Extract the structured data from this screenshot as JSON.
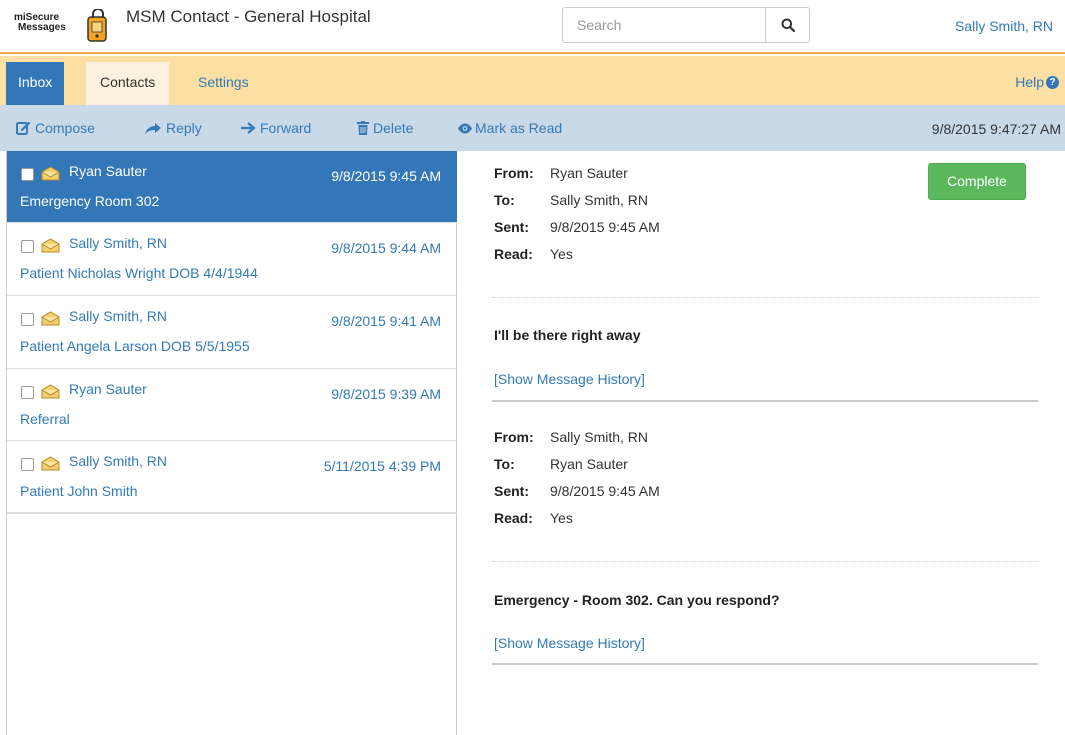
{
  "app": {
    "logo_line1": "miSecure",
    "logo_line2": "Messages",
    "title": "MSM Contact - General Hospital",
    "search_placeholder": "Search",
    "user_name": "Sally Smith, RN"
  },
  "nav": {
    "tabs": [
      {
        "label": "Inbox",
        "active": true
      },
      {
        "label": "Contacts",
        "active": false
      },
      {
        "label": "Settings",
        "active": false
      }
    ],
    "help_label": "Help",
    "help_icon": "question-circle-icon"
  },
  "toolbar": {
    "compose": "Compose",
    "reply": "Reply",
    "forward": "Forward",
    "delete": "Delete",
    "mark_read": "Mark as Read",
    "timestamp": "9/8/2015 9:47:27 AM"
  },
  "messages": [
    {
      "sender": "Ryan Sauter",
      "date": "9/8/2015 9:45 AM",
      "subject": "Emergency Room 302"
    },
    {
      "sender": "Sally Smith, RN",
      "date": "9/8/2015 9:44 AM",
      "subject": "Patient Nicholas Wright DOB 4/4/1944"
    },
    {
      "sender": "Sally Smith, RN",
      "date": "9/8/2015 9:41 AM",
      "subject": "Patient Angela Larson DOB 5/5/1955"
    },
    {
      "sender": "Ryan Sauter",
      "date": "9/8/2015 9:39 AM",
      "subject": "Referral"
    },
    {
      "sender": "Sally Smith, RN",
      "date": "5/11/2015 4:39 PM",
      "subject": "Patient John Smith"
    }
  ],
  "detail": {
    "labels": {
      "from": "From:",
      "to": "To:",
      "sent": "Sent:",
      "read": "Read:"
    },
    "complete_label": "Complete",
    "thread": [
      {
        "from": "Ryan Sauter",
        "to": "Sally Smith, RN",
        "sent": "9/8/2015 9:45 AM",
        "read": "Yes",
        "body": "I'll be there right away",
        "history": "[Show Message History]"
      },
      {
        "from": "Sally Smith, RN",
        "to": "Ryan Sauter",
        "sent": "9/8/2015 9:45 AM",
        "read": "Yes",
        "body": "Emergency - Room 302. Can you respond?",
        "history": "[Show Message History]"
      }
    ]
  },
  "colors": {
    "accent": "#3477b9",
    "nav_bg": "#fcdfa3",
    "toolbar_bg": "#c9d9e8",
    "complete": "#5cb85c",
    "header_rule": "#f0a64a"
  }
}
